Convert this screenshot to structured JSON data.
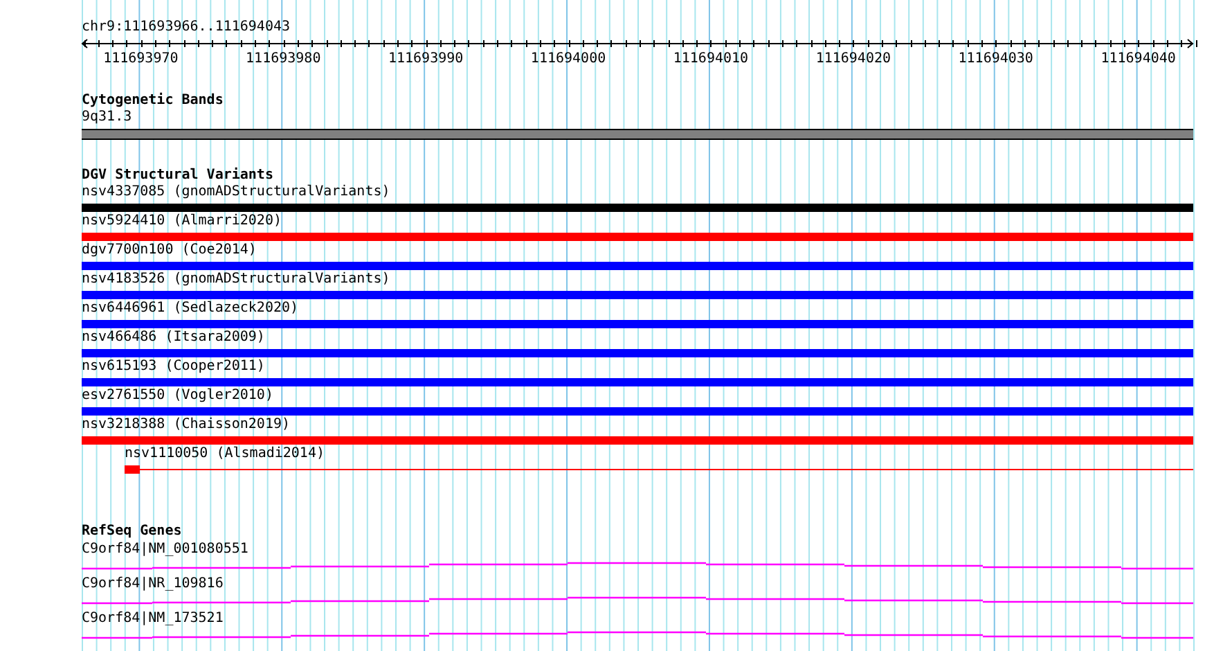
{
  "ruler": {
    "location": "chr9:111693966..111694043",
    "tick_labels": [
      "111693970",
      "111693980",
      "111693990",
      "111694000",
      "111694010",
      "111694020",
      "111694030",
      "111694040"
    ]
  },
  "cytogenetic_bands": {
    "title": "Cytogenetic Bands",
    "band": {
      "label": "9q31.3",
      "color": "#808080"
    }
  },
  "dgv": {
    "title": "DGV Structural Variants",
    "features": [
      {
        "label": "nsv4337085 (gnomADStructuralVariants)",
        "color": "#000000",
        "kind": "full"
      },
      {
        "label": "nsv5924410 (Almarri2020)",
        "color": "#ff0000",
        "kind": "full"
      },
      {
        "label": "dgv7700n100 (Coe2014)",
        "color": "#0000ff",
        "kind": "full"
      },
      {
        "label": "nsv4183526 (gnomADStructuralVariants)",
        "color": "#0000ff",
        "kind": "full"
      },
      {
        "label": "nsv6446961 (Sedlazeck2020)",
        "color": "#0000ff",
        "kind": "full"
      },
      {
        "label": "nsv466486 (Itsara2009)",
        "color": "#0000ff",
        "kind": "full"
      },
      {
        "label": "nsv615193 (Cooper2011)",
        "color": "#0000ff",
        "kind": "full"
      },
      {
        "label": "esv2761550 (Vogler2010)",
        "color": "#0000ff",
        "kind": "full"
      },
      {
        "label": "nsv3218388 (Chaisson2019)",
        "color": "#ff0000",
        "kind": "full"
      },
      {
        "label": "nsv1110050 (Alsmadi2014)",
        "color": "#ff0000",
        "kind": "partial"
      }
    ]
  },
  "refseq": {
    "title": "RefSeq Genes",
    "genes": [
      {
        "label": "C9orf84|NM_001080551"
      },
      {
        "label": "C9orf84|NR_109816"
      },
      {
        "label": "C9orf84|NM_173521"
      }
    ]
  }
}
